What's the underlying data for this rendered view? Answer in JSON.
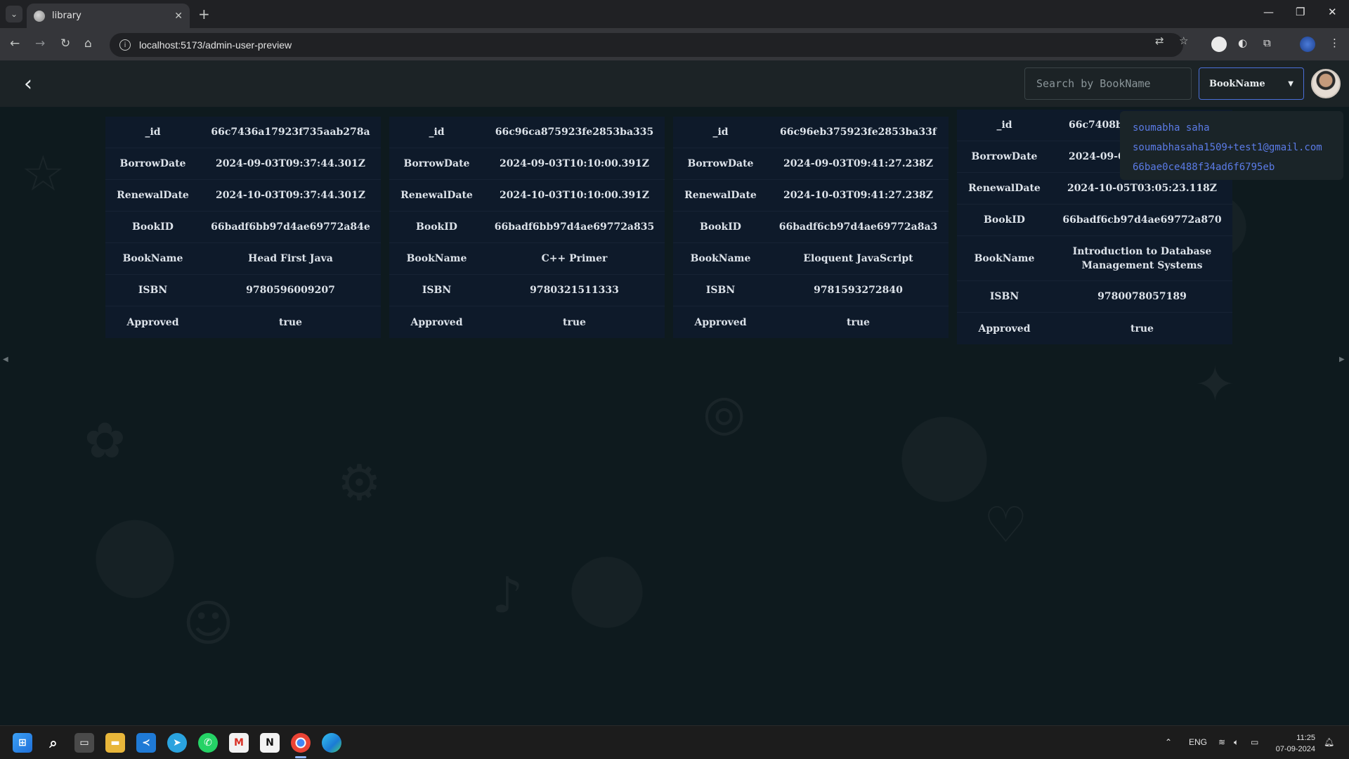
{
  "browser": {
    "tab_title": "library",
    "url": "localhost:5173/admin-user-preview"
  },
  "app": {
    "search_placeholder": "Search by BookName",
    "filter_selected": "BookName",
    "user_menu": {
      "name": "soumabha saha",
      "email": "soumabhasaha1509+test1@gmail.com",
      "id": "66bae0ce488f34ad6f6795eb"
    }
  },
  "cards": [
    {
      "rows": [
        {
          "key": "_id",
          "value": "66c7436a17923f735aab278a"
        },
        {
          "key": "BorrowDate",
          "value": "2024-09-03T09:37:44.301Z"
        },
        {
          "key": "RenewalDate",
          "value": "2024-10-03T09:37:44.301Z"
        },
        {
          "key": "BookID",
          "value": "66badf6bb97d4ae69772a84e"
        },
        {
          "key": "BookName",
          "value": "Head First Java"
        },
        {
          "key": "ISBN",
          "value": "9780596009207"
        },
        {
          "key": "Approved",
          "value": "true"
        }
      ]
    },
    {
      "rows": [
        {
          "key": "_id",
          "value": "66c96ca875923fe2853ba335"
        },
        {
          "key": "BorrowDate",
          "value": "2024-09-03T10:10:00.391Z"
        },
        {
          "key": "RenewalDate",
          "value": "2024-10-03T10:10:00.391Z"
        },
        {
          "key": "BookID",
          "value": "66badf6bb97d4ae69772a835"
        },
        {
          "key": "BookName",
          "value": "C++ Primer"
        },
        {
          "key": "ISBN",
          "value": "9780321511333"
        },
        {
          "key": "Approved",
          "value": "true"
        }
      ]
    },
    {
      "rows": [
        {
          "key": "_id",
          "value": "66c96eb375923fe2853ba33f"
        },
        {
          "key": "BorrowDate",
          "value": "2024-09-03T09:41:27.238Z"
        },
        {
          "key": "RenewalDate",
          "value": "2024-10-03T09:41:27.238Z"
        },
        {
          "key": "BookID",
          "value": "66badf6cb97d4ae69772a8a3"
        },
        {
          "key": "BookName",
          "value": "Eloquent JavaScript"
        },
        {
          "key": "ISBN",
          "value": "9781593272840"
        },
        {
          "key": "Approved",
          "value": "true"
        }
      ]
    },
    {
      "rows": [
        {
          "key": "_id",
          "value": "66c7408b1"
        },
        {
          "key": "BorrowDate",
          "value": "2024-09-0"
        },
        {
          "key": "RenewalDate",
          "value": "2024-10-05T03:05:23.118Z"
        },
        {
          "key": "BookID",
          "value": "66badf6cb97d4ae69772a870"
        },
        {
          "key": "BookName",
          "value": "Introduction to Database Management Systems"
        },
        {
          "key": "ISBN",
          "value": "9780078057189"
        },
        {
          "key": "Approved",
          "value": "true"
        }
      ]
    }
  ],
  "taskbar": {
    "language": "ENG",
    "time": "11:25",
    "date": "07-09-2024"
  },
  "icons": {
    "back": "chevron-left-icon",
    "dropdown": "caret-down-icon",
    "windows": "windows-start-icon"
  }
}
